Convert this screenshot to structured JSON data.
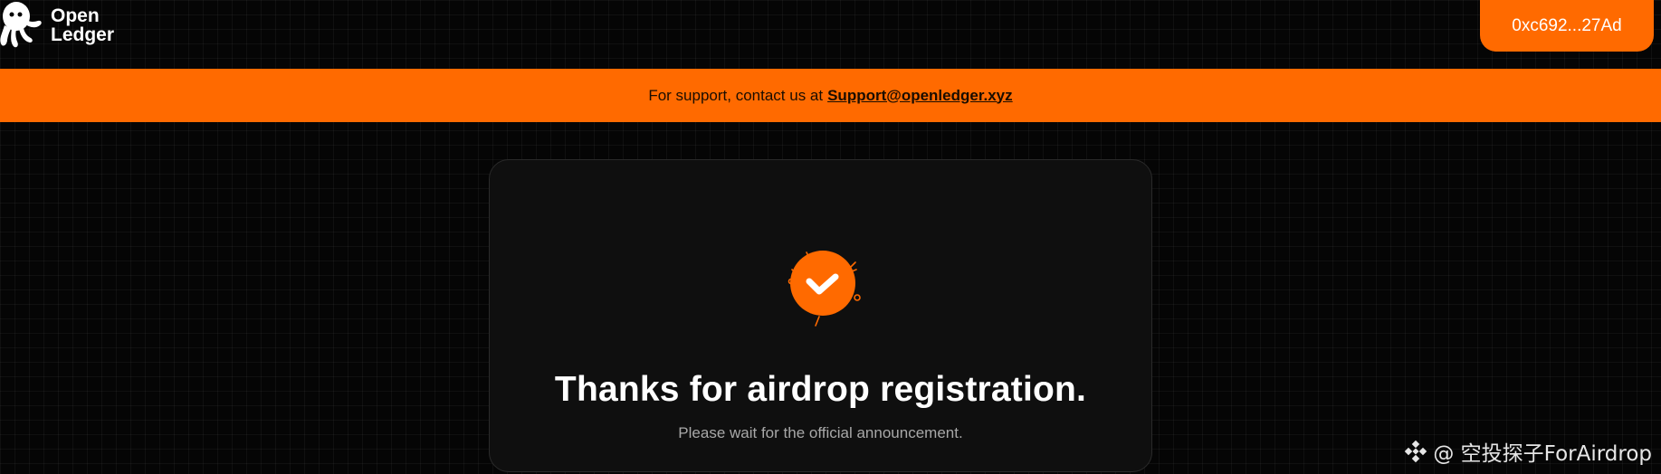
{
  "header": {
    "logo_line1": "Open",
    "logo_line2": "Ledger",
    "wallet_label": "0xc692...27Ad"
  },
  "support": {
    "text": "For support, contact us at",
    "email": "Support@openledger.xyz"
  },
  "card": {
    "title": "Thanks for airdrop registration.",
    "subtitle": "Please wait for the official announcement."
  },
  "watermark": {
    "text": "@ 空投探子ForAirdrop"
  },
  "colors": {
    "accent": "#ff6a00",
    "background": "#050505",
    "card": "#0f0f0f"
  }
}
